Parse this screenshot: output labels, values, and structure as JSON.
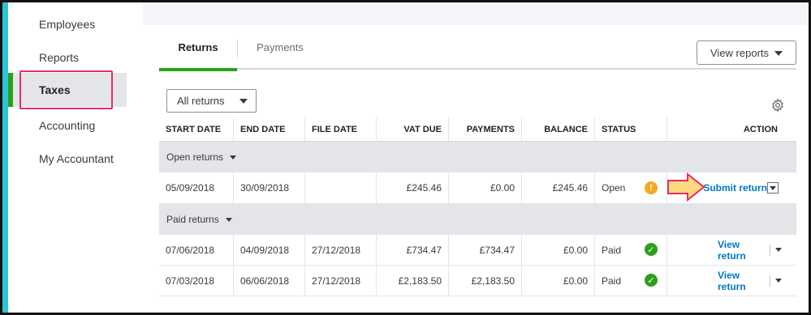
{
  "sidebar": {
    "items": [
      {
        "label": "Employees"
      },
      {
        "label": "Reports"
      },
      {
        "label": "Taxes"
      },
      {
        "label": "Accounting"
      },
      {
        "label": "My Accountant"
      }
    ]
  },
  "tabs": [
    {
      "label": "Returns"
    },
    {
      "label": "Payments"
    }
  ],
  "toolbar": {
    "view_reports_label": "View reports",
    "filter_value": "All returns"
  },
  "table": {
    "headers": [
      "START DATE",
      "END DATE",
      "FILE DATE",
      "VAT DUE",
      "PAYMENTS",
      "BALANCE",
      "STATUS",
      "ACTION"
    ],
    "groups": [
      {
        "label": "Open returns",
        "rows": [
          {
            "start": "05/09/2018",
            "end": "30/09/2018",
            "file": "",
            "vat_due": "£245.46",
            "payments": "£0.00",
            "balance": "£245.46",
            "status": "Open",
            "status_icon": "warning-icon",
            "action": "Submit return"
          }
        ]
      },
      {
        "label": "Paid returns",
        "rows": [
          {
            "start": "07/06/2018",
            "end": "04/09/2018",
            "file": "27/12/2018",
            "vat_due": "£734.47",
            "payments": "£734.47",
            "balance": "£0.00",
            "status": "Paid",
            "status_icon": "check-icon",
            "action": "View return"
          },
          {
            "start": "07/03/2018",
            "end": "06/06/2018",
            "file": "27/12/2018",
            "vat_due": "£2,183.50",
            "payments": "£2,183.50",
            "balance": "£0.00",
            "status": "Paid",
            "status_icon": "check-icon",
            "action": "View return"
          }
        ]
      }
    ]
  },
  "colors": {
    "accent_green": "#2ca01c",
    "link_blue": "#0077c5",
    "highlight_pink": "#e0306a",
    "arrow_fill": "#ffd880",
    "warning": "#f4a922"
  }
}
